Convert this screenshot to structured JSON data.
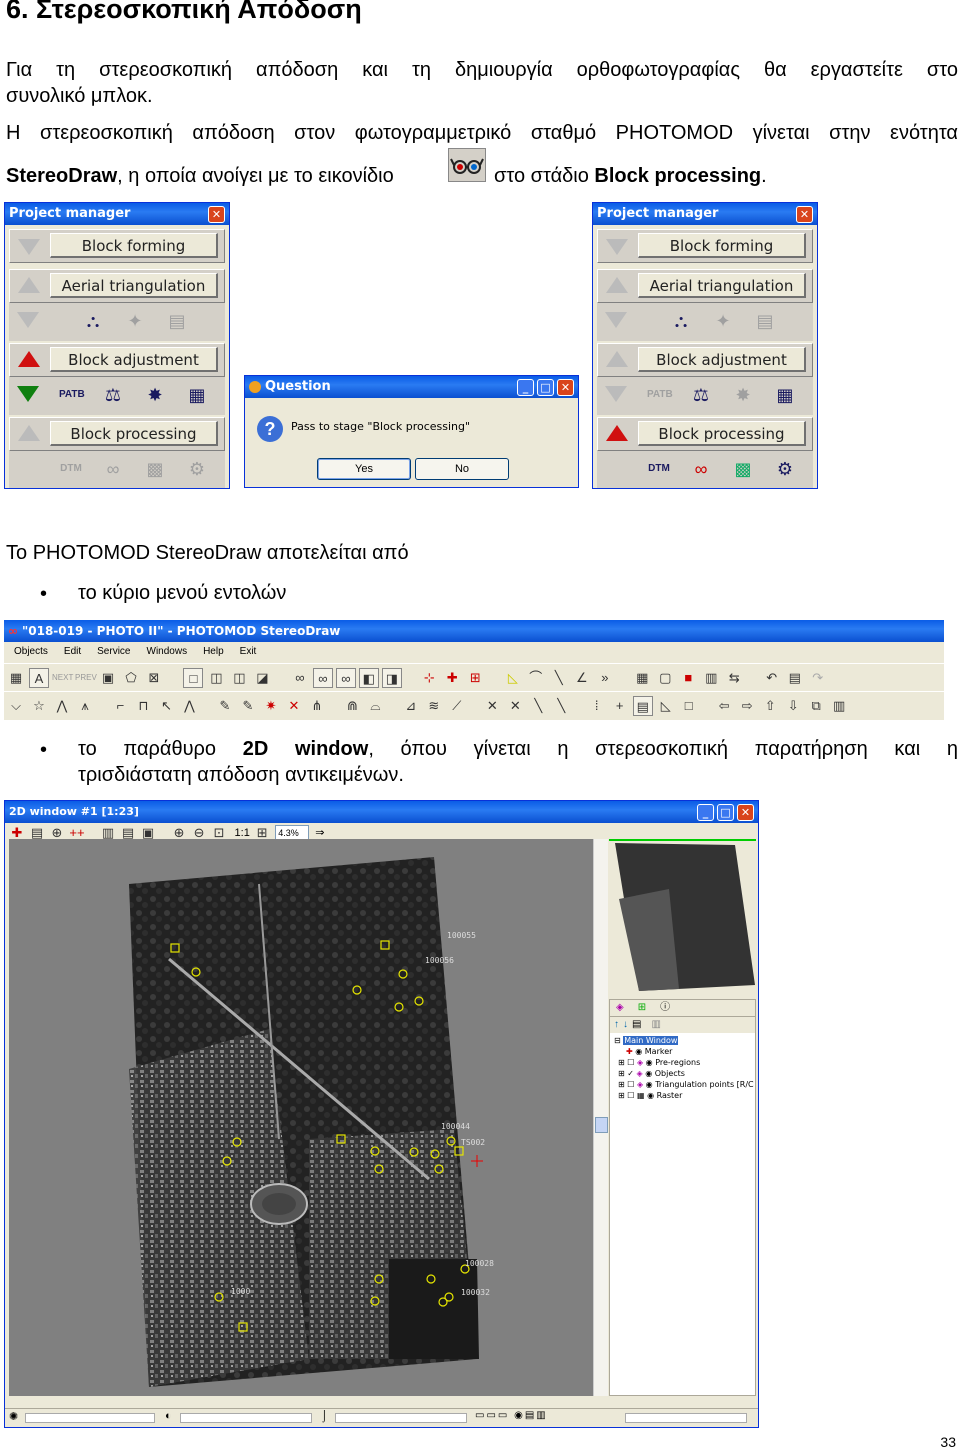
{
  "heading": "6. Στερεοσκοπική Απόδοση",
  "para1": "Για τη στερεοσκοπική απόδοση και τη δημιουργία ορθοφωτογραφίας θα εργαστείτε στο",
  "para1_line2": "συνολικό μπλοκ.",
  "para2": "Η στερεοσκοπική απόδοση στον φωτογραμμετρικό σταθμό PHOTOMOD γίνεται στην ενότητα",
  "para3_bold": "StereoDraw",
  "para3_a": ", η οποία ανοίγει με το εικονίδιο",
  "para3_b": "στο στάδιο ",
  "para3_bold2": "Block processing",
  "para3_end": ".",
  "project_manager": {
    "title": "Project manager",
    "stages": [
      "Block forming",
      "Aerial triangulation",
      "Block adjustment",
      "Block processing"
    ]
  },
  "question": {
    "title": "Question",
    "message": "Pass to stage \"Block processing\"",
    "yes": "Yes",
    "no": "No"
  },
  "para4": "Το PHOTOMOD StereoDraw αποτελείται από",
  "bullet1": "το κύριο μενού εντολών",
  "stereodraw": {
    "title": "\"018-019 - PHOTO II\" - PHOTOMOD StereoDraw",
    "menu": [
      "Objects",
      "Edit",
      "Service",
      "Windows",
      "Help",
      "Exit"
    ]
  },
  "bullet2_a": "το παράθυρο ",
  "bullet2_bold": "2D window",
  "bullet2_b": ", όπου γίνεται η στερεοσκοπική παρατήρηση και η",
  "bullet2_line2": "τρισδιάστατη απόδοση αντικειμένων.",
  "window2d": {
    "title": "2D window #1 [1:23]",
    "zoom": "4.3%",
    "scale": "1:1",
    "point_labels": [
      "100055",
      "100056",
      "100044",
      "TS002",
      "100028",
      "100032",
      "1000"
    ],
    "tree": [
      "Main Window",
      "Marker",
      "Pre-regions",
      "Objects",
      "Triangulation points [R/C",
      "Raster"
    ]
  },
  "page_number": "33"
}
